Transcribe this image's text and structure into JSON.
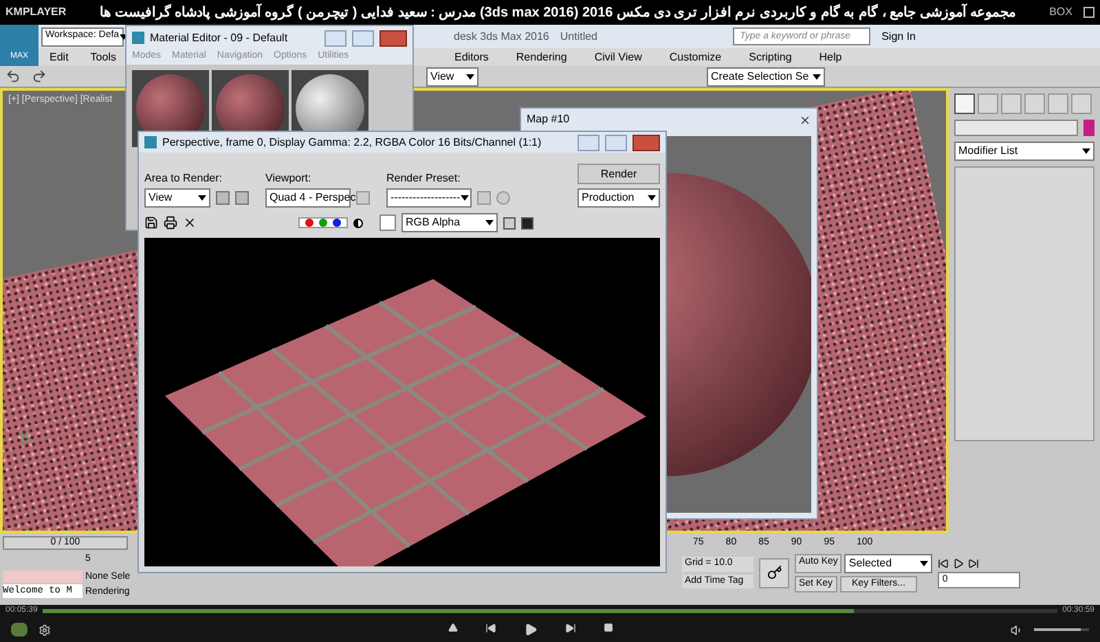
{
  "player": {
    "logo": "KMPLAYER",
    "title": "مجموعه آموزشی جامع ، گام به گام و کاربردی نرم افزار تری دی مکس 2016 (3ds max 2016)  مدرس : سعید فدایی ( تیچرمن ) گروه آموزشی پادشاه گرافیست ها",
    "box_label": "BOX",
    "elapsed": "00:05:39",
    "total": "00:30:59",
    "progress": {
      "level": 0.8
    },
    "volume": {
      "level": 0.85
    }
  },
  "max": {
    "logo": "MAX",
    "workspace": "Workspace: Defa",
    "app_title": "desk 3ds Max 2016",
    "file_name": "Untitled",
    "search": {
      "placeholder": "Type a keyword or phrase"
    },
    "sign_in": "Sign In",
    "menus_left": [
      "Edit",
      "Tools"
    ],
    "menus_right": [
      "Editors",
      "Rendering",
      "Civil View",
      "Customize",
      "Scripting",
      "Help"
    ],
    "view_dropdown": "View",
    "selection_set": "Create Selection Se",
    "viewport_label": "[+] [Perspective] [Realist",
    "command_tabs": [
      {
        "selected": true
      },
      {
        "selected": false
      },
      {
        "selected": false
      },
      {
        "selected": false
      },
      {
        "selected": false
      },
      {
        "selected": false
      }
    ],
    "modifier_list": "Modifier List"
  },
  "material_editor": {
    "title": "Material Editor - 09 - Default",
    "menus": [
      "Modes",
      "Material",
      "Navigation",
      "Options",
      "Utilities"
    ]
  },
  "map_window": {
    "title": "Map #10"
  },
  "render_window": {
    "title": "Perspective, frame 0, Display Gamma: 2.2, RGBA Color 16 Bits/Channel (1:1)",
    "area_label": "Area to Render:",
    "area_value": "View",
    "viewport_label": "Viewport:",
    "viewport_value": "Quad 4 - Perspec",
    "preset_label": "Render Preset:",
    "preset_value": "-------------------",
    "render_button": "Render",
    "production": "Production",
    "channels": [
      {
        "color": "#e01010"
      },
      {
        "color": "#10a010"
      },
      {
        "color": "#1020e0"
      }
    ],
    "channel_display": "RGB Alpha"
  },
  "bottom": {
    "time_slider": "0 / 100",
    "left_tick": "5",
    "ticks": [
      "75",
      "80",
      "85",
      "90",
      "95",
      "100"
    ],
    "listener": "Welcome to M",
    "status": "None Sele",
    "rendering": "Rendering",
    "grid": "Grid = 10.0",
    "add_time_tag": "Add Time Tag",
    "auto_key": "Auto Key",
    "selected": "Selected",
    "set_key": "Set Key",
    "key_filters": "Key Filters...",
    "frame": "0"
  }
}
